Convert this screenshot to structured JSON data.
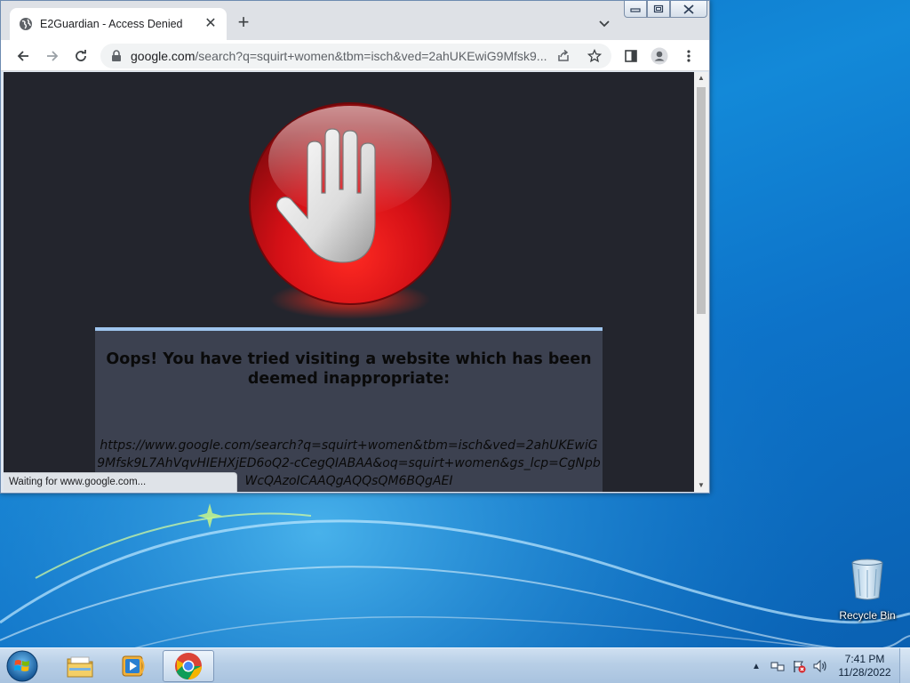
{
  "browser": {
    "tab": {
      "title": "E2Guardian - Access Denied",
      "icon": "globe-icon",
      "close_icon": "close-icon"
    },
    "new_tab_label": "+",
    "omnibox": {
      "host": "google.com",
      "path": "/search?q=squirt+women&tbm=isch&ved=2ahUKEwiG9Mfsk9..."
    },
    "status_text": "Waiting for www.google.com..."
  },
  "page": {
    "heading": "Oops! You have tried visiting a website which has been deemed inappropriate:",
    "blocked_url": "https://www.google.com/search?q=squirt+women&tbm=isch&ved=2ahUKEwiG9Mfsk9L7AhVqvHIEHXjED6oQ2-cCegQIABAA&oq=squirt+women&gs_lcp=CgNpbWcQAzoICAAQgAQQsQM6BQgAEI"
  },
  "desktop": {
    "recycle_bin_label": "Recycle Bin"
  },
  "taskbar": {
    "clock_time": "7:41 PM",
    "clock_date": "11/28/2022"
  },
  "colors": {
    "page_background": "#23252d",
    "deny_box": "#3c4150",
    "deny_box_border": "#9ec5ee",
    "stop_red": "#d9141a"
  }
}
